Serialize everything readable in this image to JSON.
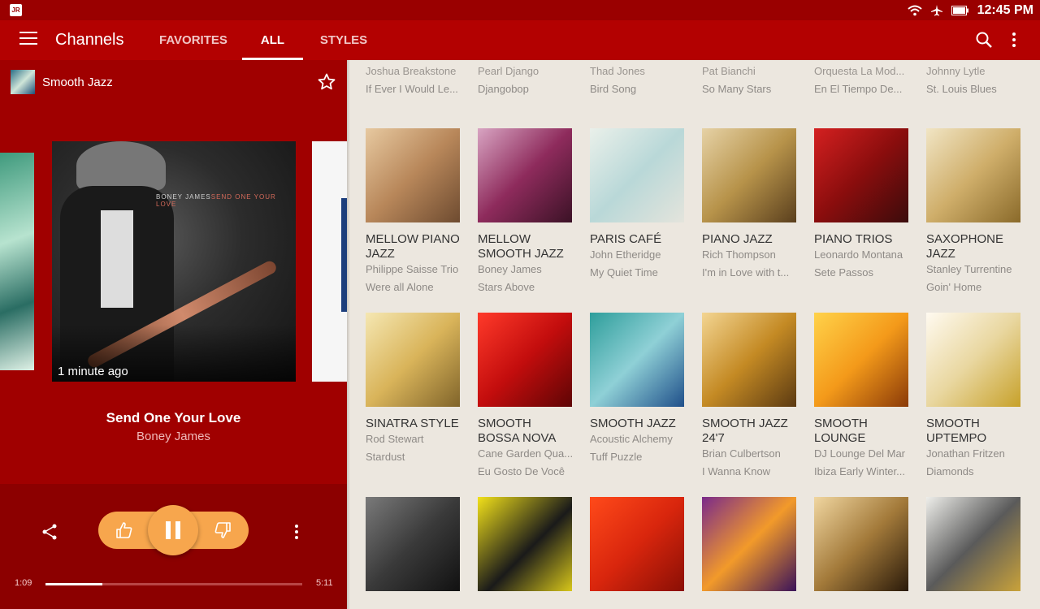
{
  "status": {
    "time": "12:45 PM",
    "badge": "JR"
  },
  "appbar": {
    "title": "Channels",
    "tabs": [
      {
        "label": "FAVORITES"
      },
      {
        "label": "ALL"
      },
      {
        "label": "STYLES"
      }
    ]
  },
  "now_playing": {
    "station": "Smooth Jazz",
    "album_caption_artist": "BONEY JAMES",
    "album_caption_title": "SEND ONE YOUR LOVE",
    "time_ago": "1 minute ago",
    "track_title": "Send One Your Love",
    "track_artist": "Boney James",
    "elapsed": "1:09",
    "total": "5:11",
    "progress": 0.22
  },
  "top_row": [
    {
      "artist": "Joshua Breakstone",
      "song": "If Ever I Would Le..."
    },
    {
      "artist": "Pearl Django",
      "song": "Djangobop"
    },
    {
      "artist": "Thad Jones",
      "song": "Bird Song"
    },
    {
      "artist": "Pat Bianchi",
      "song": "So Many Stars"
    },
    {
      "artist": "Orquesta La Mod...",
      "song": "En El Tiempo De..."
    },
    {
      "artist": "Johnny Lytle",
      "song": "St. Louis Blues"
    }
  ],
  "rows": [
    [
      {
        "name": "MELLOW PIANO JAZZ",
        "artist": "Philippe Saisse Trio",
        "song": "Were all Alone"
      },
      {
        "name": "MELLOW SMOOTH JAZZ",
        "artist": "Boney James",
        "song": "Stars Above"
      },
      {
        "name": "PARIS CAFÉ",
        "artist": "John Etheridge",
        "song": "My Quiet Time"
      },
      {
        "name": "PIANO JAZZ",
        "artist": "Rich Thompson",
        "song": "I'm in Love with t..."
      },
      {
        "name": "PIANO TRIOS",
        "artist": "Leonardo Montana",
        "song": "Sete Passos"
      },
      {
        "name": "SAXOPHONE JAZZ",
        "artist": "Stanley Turrentine",
        "song": "Goin' Home"
      }
    ],
    [
      {
        "name": "SINATRA STYLE",
        "artist": "Rod Stewart",
        "song": "Stardust"
      },
      {
        "name": "SMOOTH BOSSA NOVA",
        "artist": "Cane Garden Qua...",
        "song": "Eu Gosto De Você"
      },
      {
        "name": "SMOOTH JAZZ",
        "artist": "Acoustic Alchemy",
        "song": "Tuff Puzzle"
      },
      {
        "name": "SMOOTH JAZZ 24'7",
        "artist": "Brian Culbertson",
        "song": "I Wanna Know"
      },
      {
        "name": "SMOOTH LOUNGE",
        "artist": "DJ Lounge Del Mar",
        "song": "Ibiza Early Winter..."
      },
      {
        "name": "SMOOTH UPTEMPO",
        "artist": "Jonathan Fritzen",
        "song": "Diamonds"
      }
    ]
  ],
  "colors": {
    "accent": "#b30101",
    "panel": "#a00000",
    "control": "#f7a64d",
    "grid_bg": "#ece7df"
  }
}
